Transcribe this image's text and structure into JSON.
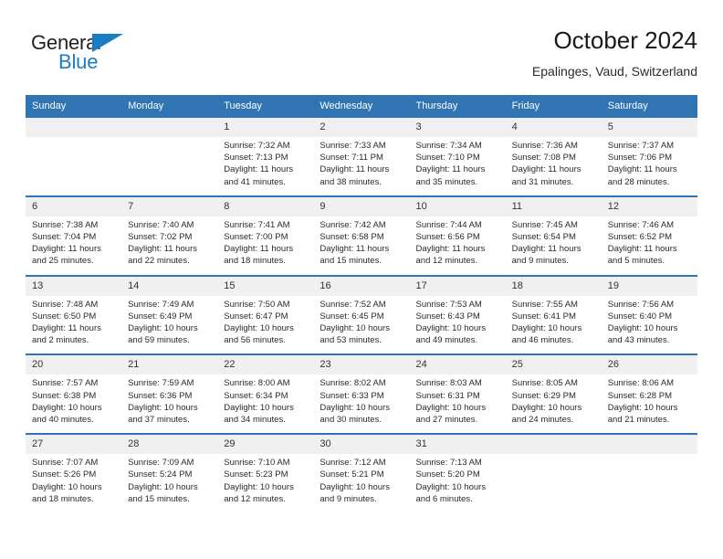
{
  "brand": {
    "name_top": "General",
    "name_bottom": "Blue",
    "triangle_icon": "triangle-icon",
    "color_blue": "#1a7dc4",
    "color_dark": "#231f20"
  },
  "header": {
    "title": "October 2024",
    "subtitle": "Epalinges, Vaud, Switzerland"
  },
  "theme": {
    "header_blue": "#3074b4",
    "daynum_band": "#f0f0f0",
    "text": "#2a2a2a"
  },
  "weekdays": [
    "Sunday",
    "Monday",
    "Tuesday",
    "Wednesday",
    "Thursday",
    "Friday",
    "Saturday"
  ],
  "labels": {
    "sunrise_prefix": "Sunrise:",
    "sunset_prefix": "Sunset:",
    "daylight_prefix": "Daylight:"
  },
  "weeks": [
    [
      {
        "day": "",
        "sunrise": "",
        "sunset": "",
        "daylight_l1": "",
        "daylight_l2": ""
      },
      {
        "day": "",
        "sunrise": "",
        "sunset": "",
        "daylight_l1": "",
        "daylight_l2": ""
      },
      {
        "day": "1",
        "sunrise": "Sunrise: 7:32 AM",
        "sunset": "Sunset: 7:13 PM",
        "daylight_l1": "Daylight: 11 hours",
        "daylight_l2": "and 41 minutes."
      },
      {
        "day": "2",
        "sunrise": "Sunrise: 7:33 AM",
        "sunset": "Sunset: 7:11 PM",
        "daylight_l1": "Daylight: 11 hours",
        "daylight_l2": "and 38 minutes."
      },
      {
        "day": "3",
        "sunrise": "Sunrise: 7:34 AM",
        "sunset": "Sunset: 7:10 PM",
        "daylight_l1": "Daylight: 11 hours",
        "daylight_l2": "and 35 minutes."
      },
      {
        "day": "4",
        "sunrise": "Sunrise: 7:36 AM",
        "sunset": "Sunset: 7:08 PM",
        "daylight_l1": "Daylight: 11 hours",
        "daylight_l2": "and 31 minutes."
      },
      {
        "day": "5",
        "sunrise": "Sunrise: 7:37 AM",
        "sunset": "Sunset: 7:06 PM",
        "daylight_l1": "Daylight: 11 hours",
        "daylight_l2": "and 28 minutes."
      }
    ],
    [
      {
        "day": "6",
        "sunrise": "Sunrise: 7:38 AM",
        "sunset": "Sunset: 7:04 PM",
        "daylight_l1": "Daylight: 11 hours",
        "daylight_l2": "and 25 minutes."
      },
      {
        "day": "7",
        "sunrise": "Sunrise: 7:40 AM",
        "sunset": "Sunset: 7:02 PM",
        "daylight_l1": "Daylight: 11 hours",
        "daylight_l2": "and 22 minutes."
      },
      {
        "day": "8",
        "sunrise": "Sunrise: 7:41 AM",
        "sunset": "Sunset: 7:00 PM",
        "daylight_l1": "Daylight: 11 hours",
        "daylight_l2": "and 18 minutes."
      },
      {
        "day": "9",
        "sunrise": "Sunrise: 7:42 AM",
        "sunset": "Sunset: 6:58 PM",
        "daylight_l1": "Daylight: 11 hours",
        "daylight_l2": "and 15 minutes."
      },
      {
        "day": "10",
        "sunrise": "Sunrise: 7:44 AM",
        "sunset": "Sunset: 6:56 PM",
        "daylight_l1": "Daylight: 11 hours",
        "daylight_l2": "and 12 minutes."
      },
      {
        "day": "11",
        "sunrise": "Sunrise: 7:45 AM",
        "sunset": "Sunset: 6:54 PM",
        "daylight_l1": "Daylight: 11 hours",
        "daylight_l2": "and 9 minutes."
      },
      {
        "day": "12",
        "sunrise": "Sunrise: 7:46 AM",
        "sunset": "Sunset: 6:52 PM",
        "daylight_l1": "Daylight: 11 hours",
        "daylight_l2": "and 5 minutes."
      }
    ],
    [
      {
        "day": "13",
        "sunrise": "Sunrise: 7:48 AM",
        "sunset": "Sunset: 6:50 PM",
        "daylight_l1": "Daylight: 11 hours",
        "daylight_l2": "and 2 minutes."
      },
      {
        "day": "14",
        "sunrise": "Sunrise: 7:49 AM",
        "sunset": "Sunset: 6:49 PM",
        "daylight_l1": "Daylight: 10 hours",
        "daylight_l2": "and 59 minutes."
      },
      {
        "day": "15",
        "sunrise": "Sunrise: 7:50 AM",
        "sunset": "Sunset: 6:47 PM",
        "daylight_l1": "Daylight: 10 hours",
        "daylight_l2": "and 56 minutes."
      },
      {
        "day": "16",
        "sunrise": "Sunrise: 7:52 AM",
        "sunset": "Sunset: 6:45 PM",
        "daylight_l1": "Daylight: 10 hours",
        "daylight_l2": "and 53 minutes."
      },
      {
        "day": "17",
        "sunrise": "Sunrise: 7:53 AM",
        "sunset": "Sunset: 6:43 PM",
        "daylight_l1": "Daylight: 10 hours",
        "daylight_l2": "and 49 minutes."
      },
      {
        "day": "18",
        "sunrise": "Sunrise: 7:55 AM",
        "sunset": "Sunset: 6:41 PM",
        "daylight_l1": "Daylight: 10 hours",
        "daylight_l2": "and 46 minutes."
      },
      {
        "day": "19",
        "sunrise": "Sunrise: 7:56 AM",
        "sunset": "Sunset: 6:40 PM",
        "daylight_l1": "Daylight: 10 hours",
        "daylight_l2": "and 43 minutes."
      }
    ],
    [
      {
        "day": "20",
        "sunrise": "Sunrise: 7:57 AM",
        "sunset": "Sunset: 6:38 PM",
        "daylight_l1": "Daylight: 10 hours",
        "daylight_l2": "and 40 minutes."
      },
      {
        "day": "21",
        "sunrise": "Sunrise: 7:59 AM",
        "sunset": "Sunset: 6:36 PM",
        "daylight_l1": "Daylight: 10 hours",
        "daylight_l2": "and 37 minutes."
      },
      {
        "day": "22",
        "sunrise": "Sunrise: 8:00 AM",
        "sunset": "Sunset: 6:34 PM",
        "daylight_l1": "Daylight: 10 hours",
        "daylight_l2": "and 34 minutes."
      },
      {
        "day": "23",
        "sunrise": "Sunrise: 8:02 AM",
        "sunset": "Sunset: 6:33 PM",
        "daylight_l1": "Daylight: 10 hours",
        "daylight_l2": "and 30 minutes."
      },
      {
        "day": "24",
        "sunrise": "Sunrise: 8:03 AM",
        "sunset": "Sunset: 6:31 PM",
        "daylight_l1": "Daylight: 10 hours",
        "daylight_l2": "and 27 minutes."
      },
      {
        "day": "25",
        "sunrise": "Sunrise: 8:05 AM",
        "sunset": "Sunset: 6:29 PM",
        "daylight_l1": "Daylight: 10 hours",
        "daylight_l2": "and 24 minutes."
      },
      {
        "day": "26",
        "sunrise": "Sunrise: 8:06 AM",
        "sunset": "Sunset: 6:28 PM",
        "daylight_l1": "Daylight: 10 hours",
        "daylight_l2": "and 21 minutes."
      }
    ],
    [
      {
        "day": "27",
        "sunrise": "Sunrise: 7:07 AM",
        "sunset": "Sunset: 5:26 PM",
        "daylight_l1": "Daylight: 10 hours",
        "daylight_l2": "and 18 minutes."
      },
      {
        "day": "28",
        "sunrise": "Sunrise: 7:09 AM",
        "sunset": "Sunset: 5:24 PM",
        "daylight_l1": "Daylight: 10 hours",
        "daylight_l2": "and 15 minutes."
      },
      {
        "day": "29",
        "sunrise": "Sunrise: 7:10 AM",
        "sunset": "Sunset: 5:23 PM",
        "daylight_l1": "Daylight: 10 hours",
        "daylight_l2": "and 12 minutes."
      },
      {
        "day": "30",
        "sunrise": "Sunrise: 7:12 AM",
        "sunset": "Sunset: 5:21 PM",
        "daylight_l1": "Daylight: 10 hours",
        "daylight_l2": "and 9 minutes."
      },
      {
        "day": "31",
        "sunrise": "Sunrise: 7:13 AM",
        "sunset": "Sunset: 5:20 PM",
        "daylight_l1": "Daylight: 10 hours",
        "daylight_l2": "and 6 minutes."
      },
      {
        "day": "",
        "sunrise": "",
        "sunset": "",
        "daylight_l1": "",
        "daylight_l2": ""
      },
      {
        "day": "",
        "sunrise": "",
        "sunset": "",
        "daylight_l1": "",
        "daylight_l2": ""
      }
    ]
  ]
}
